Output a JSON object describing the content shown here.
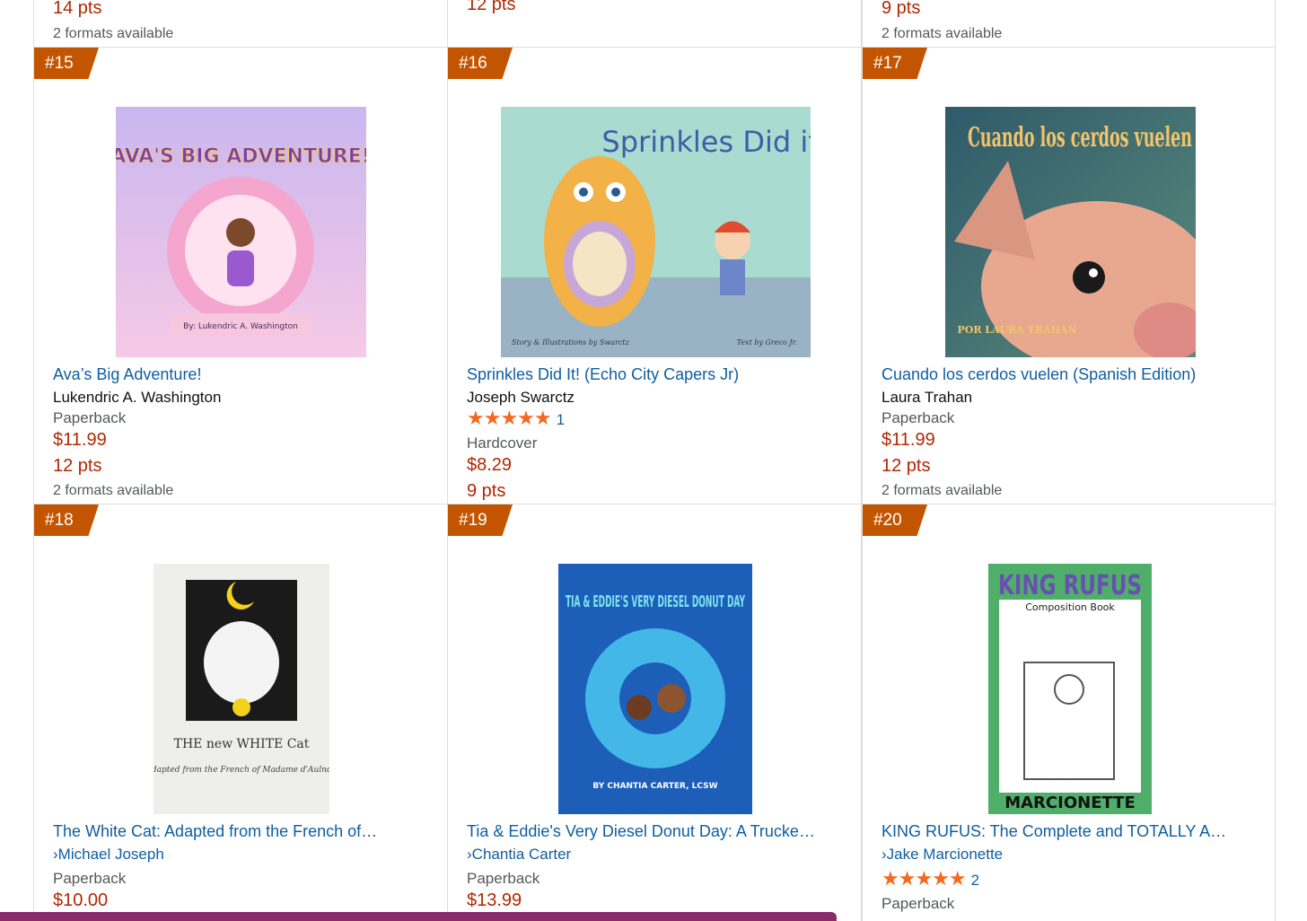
{
  "top_row": [
    {
      "pts": "14 pts",
      "formats": "2 formats available"
    },
    {
      "pts": "12 pts",
      "formats": ""
    },
    {
      "pts": "9 pts",
      "formats": "2 formats available"
    }
  ],
  "items": [
    {
      "rank": "#15",
      "title": "Ava’s Big Adventure!",
      "author": "Lukendric A. Washington",
      "format": "Paperback",
      "price": "$11.99",
      "pts": "12 pts",
      "formats": "2 formats available",
      "cover_text": "AVA'S BIG ADVENTURE!",
      "cover_sub": "By: Lukendric A. Washington"
    },
    {
      "rank": "#16",
      "title": "Sprinkles Did It! (Echo City Capers Jr)",
      "author": "Joseph Swarctz",
      "rating_count": "1",
      "format": "Hardcover",
      "price": "$8.29",
      "pts": "9 pts",
      "cover_text": "Sprinkles Did it!",
      "cover_sub_left": "Story & Illustrations by Swarctz",
      "cover_sub_right": "Text by Greco Jr."
    },
    {
      "rank": "#17",
      "title": "Cuando los cerdos vuelen (Spanish Edition)",
      "author": "Laura Trahan",
      "format": "Paperback",
      "price": "$11.99",
      "pts": "12 pts",
      "formats": "2 formats available",
      "cover_text": "Cuando los cerdos vuelen",
      "cover_sub": "POR LAURA TRAHAN"
    },
    {
      "rank": "#18",
      "title": "The White Cat: Adapted from the French of…",
      "author": "Michael Joseph",
      "format": "Paperback",
      "price": "$10.00",
      "cover_text": "THE new WHITE Cat",
      "cover_sub": "adapted from the French of Madame d'Aulnoy"
    },
    {
      "rank": "#19",
      "title": "Tia & Eddie's Very Diesel Donut Day: A Trucker's…",
      "author": "Chantia Carter",
      "format": "Paperback",
      "price": "$13.99",
      "cover_text": "TIA & EDDIE'S VERY DIESEL DONUT DAY",
      "cover_sub": "BY CHANTIA CARTER, LCSW"
    },
    {
      "rank": "#20",
      "title": "KING RUFUS: The Complete and TOTALLY Accur…",
      "author": "Jake Marcionette",
      "rating_count": "2",
      "format": "Paperback",
      "cover_text": "KING RUFUS",
      "cover_sub": "Composition Book",
      "cover_sub2": "MARCIONETTE"
    }
  ],
  "author_prefix": "›",
  "stars_glyph": "★★★★★",
  "colors": {
    "link": "#0f5ea0",
    "price": "#b12704",
    "rank_badge": "#c45500",
    "stars": "#f3691f"
  }
}
